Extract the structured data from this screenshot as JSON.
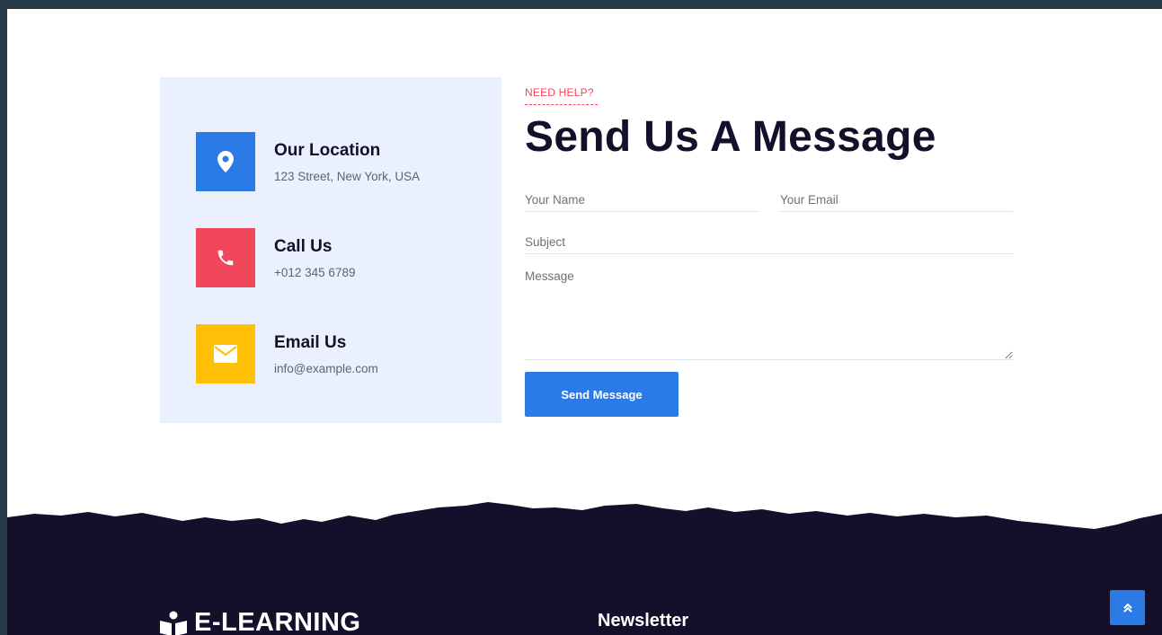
{
  "contact": {
    "items": [
      {
        "title": "Our Location",
        "detail": "123 Street, New York, USA",
        "icon": "map-pin-icon",
        "color": "#2b7be6"
      },
      {
        "title": "Call Us",
        "detail": "+012 345 6789",
        "icon": "phone-icon",
        "color": "#f0475b"
      },
      {
        "title": "Email Us",
        "detail": "info@example.com",
        "icon": "envelope-icon",
        "color": "#ffc107"
      }
    ]
  },
  "form": {
    "kicker": "NEED HELP?",
    "title": "Send Us A Message",
    "name_placeholder": "Your Name",
    "email_placeholder": "Your Email",
    "subject_placeholder": "Subject",
    "message_placeholder": "Message",
    "submit_label": "Send Message"
  },
  "footer": {
    "logo_text": "E-LEARNING",
    "newsletter_heading": "Newsletter",
    "scroll_top_icon": "double-chevron-up-icon"
  },
  "colors": {
    "primary": "#2b7be6",
    "accent": "#f0475b",
    "warning": "#ffc107",
    "dark": "#12102a",
    "panel": "#eaf0fd"
  }
}
